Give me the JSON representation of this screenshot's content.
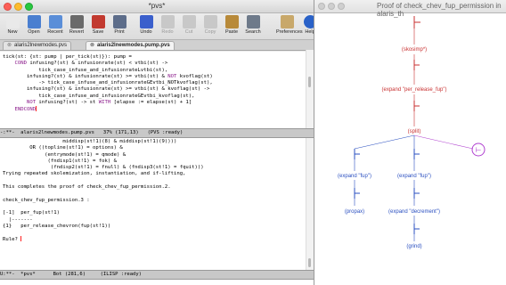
{
  "emacs": {
    "title": "*pvs*",
    "toolbar": [
      {
        "label": "New",
        "icon": "new-file-icon",
        "color": "#e9e9e9",
        "enabled": true
      },
      {
        "label": "Open",
        "icon": "open-folder-icon",
        "color": "#4a7fd0",
        "enabled": true
      },
      {
        "label": "Recent",
        "icon": "recent-icon",
        "color": "#5a8ed8",
        "enabled": true
      },
      {
        "label": "Revert",
        "icon": "revert-icon",
        "color": "#6a6a6a",
        "enabled": true
      },
      {
        "label": "Save",
        "icon": "save-icon",
        "color": "#c23a30",
        "enabled": true
      },
      {
        "label": "Print",
        "icon": "print-icon",
        "color": "#5d6d8a",
        "enabled": true
      },
      {
        "label": "Undo",
        "icon": "undo-icon",
        "color": "#3a5fcc",
        "enabled": true
      },
      {
        "label": "Redo",
        "icon": "redo-icon",
        "color": "#c8c8c8",
        "enabled": false
      },
      {
        "label": "Cut",
        "icon": "cut-icon",
        "color": "#c8c8c8",
        "enabled": false
      },
      {
        "label": "Copy",
        "icon": "copy-icon",
        "color": "#c8c8c8",
        "enabled": false
      },
      {
        "label": "Paste",
        "icon": "paste-icon",
        "color": "#b88a3a",
        "enabled": true
      },
      {
        "label": "Search",
        "icon": "search-icon",
        "color": "#6e7a8a",
        "enabled": true
      },
      {
        "label": "Preferences",
        "icon": "preferences-icon",
        "color": "#c8a86a",
        "enabled": true
      },
      {
        "label": "Help",
        "icon": "help-icon",
        "color": "#2a62c8",
        "enabled": true
      }
    ],
    "tabs": [
      "alaris2lnewmodes.pvs",
      "alaris2lnewmodes.pump.pvs"
    ],
    "top_code": [
      "tick(st: {st: pump | per_tick(st)}): pump =",
      "    COND infusing?(st) & infusionrate(st) < vtbi(st) ->",
      "            tick_case_infuse_and_infusionrateLvtbi(st),",
      "        infusing?(st) & infusionrate(st) >= vtbi(st) & NOT kvoflag(st)",
      "            -> tick_case_infuse_and_infusionrateGEvtbi_NOTkvoflag(st),",
      "        infusing?(st) & infusionrate(st) >= vtbi(st) & kvoflag(st) ->",
      "            tick_case_infuse_and_infusionrateGEvtbi_kvoflag(st),",
      "        NOT infusing?(st) -> st WITH [elapse := elapse(st) + 1]",
      "    ENDCOND"
    ],
    "top_modeline": "-:**-  alaris2lnewmodes.pump.pvs   37% (171,13)   (PVS :ready)",
    "bottom_lines": [
      "                    middisp(st!1)(8) & middisp(st!1)(9))))",
      "         OR ((topline(st!1) = options) &",
      "              (entrymode(st!1) = qmode) &",
      "               (fndisp1(st!1) = fok) &",
      "                (fndisp2(st!1) = fnull) & (fndisp3(st!1) = fquit)))",
      "Trying repeated skolemization, instantiation, and if-lifting,",
      "",
      "This completes the proof of check_chev_fup_permission.2.",
      "",
      "check_chev_fup_permission.3 :",
      "",
      "[-1]  per_fup(st!1)",
      "  |-------",
      "{1}   per_release_chevron(fup(st!1))",
      "",
      "Rule? "
    ],
    "bottom_modeline": "U:**-  *pvs*      Bot (281,6)     (ILISP :ready)"
  },
  "proof_window": {
    "title": "Proof of check_chev_fup_permission in alaris_th",
    "nodes": {
      "skosimp": "(skosimp*)",
      "expand_release": "(expand \"per_release_fup\")",
      "split": "(split)",
      "expand_fup_1": "(expand \"fup\")",
      "expand_fup_2": "(expand \"fup\")",
      "propax": "(propax)",
      "expand_decrement": "(expand \"decrement\")",
      "grind": "(grind)",
      "pending_marker": "⊢"
    },
    "colors": {
      "complete": "#2a4fc0",
      "current": "#c83030",
      "pending": "#b040d0"
    }
  }
}
